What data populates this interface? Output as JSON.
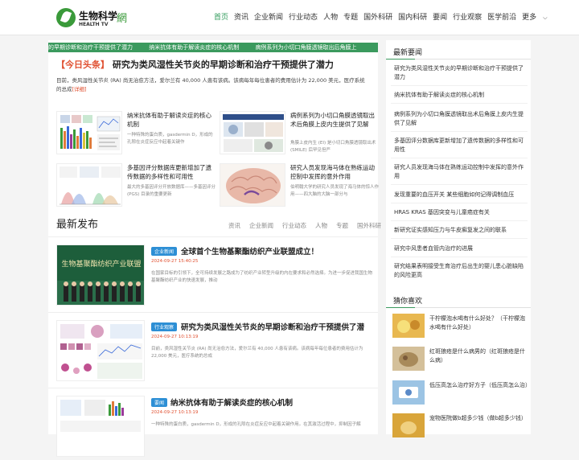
{
  "header": {
    "logo_cn": "生物科学",
    "logo_en": "HEALTH TV",
    "logo_mark": "網",
    "nav": [
      "首页",
      "资讯",
      "企业新闻",
      "行业动态",
      "人物",
      "专题",
      "国外科研",
      "国内科研",
      "要闻",
      "行业观察",
      "医学前沿",
      "更多"
    ],
    "nav_active": 0
  },
  "ticker": [
    "的早期诊断和治疗干预提供了潜力",
    "纳米抗体有助于解读炎症的核心机制",
    "病例系列为小切口角膜透镜取出后角膜上"
  ],
  "headline": {
    "tag": "【今日头条】",
    "title": "研究为类风湿性关节炎的早期诊断和治疗干预提供了潜力",
    "summary": "目前，类风湿性关节炎 (RA) 尚无治愈方法，爱尔兰有 40,000 人患有该病。该病每年每位患者的费用估计为 22,000 美元，医疗系统的总成",
    "more": "[详细]"
  },
  "cards": [
    {
      "title": "纳米抗体有助于解读炎症的核心机制",
      "desc": "一种特殊的蛋白质，gasdermin D，形成的孔隙在炎症反应中起着关键作"
    },
    {
      "title": "病例系列为小切口角膜透镜取出术后角膜上皮内生提供了见解",
      "desc": "角膜上皮内生 (EI) 是小切口角膜透镜取出术 (SMILE) 后罕见但严"
    },
    {
      "title": "多基因评分数据库更新增加了遗传数据的多样性和可用性",
      "desc": "最大的多基因评分开放数据库——多基因评分 (PGS) 目录的重要更新"
    },
    {
      "title": "研究人员发现海马体在熟练运动控制中发挥的意外作用",
      "desc": "伯明翰大学的研究人员发现了海马体的惊人作用——四大脑的大脑一部分与"
    }
  ],
  "latest": {
    "title": "最新发布",
    "tabs": [
      "资讯",
      "企业新闻",
      "行业动态",
      "人物",
      "专题",
      "国外科研"
    ]
  },
  "articles": [
    {
      "badge": "企业新闻",
      "title": "全球首个生物基聚酯纺织产业联盟成立！",
      "date": "2024-09-27 15:40:25",
      "desc": "在国家目标的引领下，全可持续发展之路成为了纺织产业转型升级的内在要求和必然选择。为进一步促进我国生物基聚酯纺织产业的快速发展，推动",
      "img_text": "生物基聚酯纺织产业联盟"
    },
    {
      "badge": "行业观察",
      "title": "研究为类风湿性关节炎的早期诊断和治疗干预提供了潜",
      "date": "2024-09-27 10:13:19",
      "desc": "目前，类风湿性关节炎 (RA) 尚无治愈方法，爱尔兰有 40,000 人患有该病。该病每年每位患者的费用估计为 22,000 美元，医疗系统的总成"
    },
    {
      "badge": "要闻",
      "title": "纳米抗体有助于解读炎症的核心机制",
      "date": "2024-09-27 10:13:19",
      "desc": "一种特殊的蛋白质，gasdermin D，形成的孔隙在炎症反应中起着关键作用。在其激活过程中，抑制因子解"
    }
  ],
  "sidebar": {
    "news_title": "最新要闻",
    "news": [
      "研究为类风湿性关节炎的早期诊断和治疗干预提供了潜力",
      "纳米抗体有助于解读炎症的核心机制",
      "病例系列为小切口角膜透镜取出术后角膜上皮内生提供了见解",
      "多基因评分数据库更新增加了遗传数据的多样性和可用性",
      "研究人员发现海马体在熟练运动控制中发挥的意外作用",
      "发现重要的血压开关 某些细胞如何记得调制血压",
      "HRAS KRAS 基因突变与儿童癌症有关",
      "新研究证实感知压力与牛皮癣复发之间的联系",
      "研究中风患者血管内治疗的进展",
      "研究结果表明接受生育治疗后出生的婴儿患心脏缺陷的风险更高"
    ],
    "guess_title": "猜你喜欢",
    "guess": [
      {
        "title": "干柠檬泡水喝有什么好处？（干柠檬泡水喝有什么好处）",
        "color": "#d9a53a"
      },
      {
        "title": "红斑狼疮是什么病男的（红斑狼疮是什么病）",
        "color": "#c9b27a"
      },
      {
        "title": "低压高怎么治疗好方子（低压高怎么治）",
        "color": "#7bb0d9"
      },
      {
        "title": "宠物医院做b超多少钱（做b超多少钱）",
        "color": "#d9a53a"
      }
    ]
  },
  "colors": {
    "accent": "#3b9a5e",
    "headline_tag": "#e05030",
    "badge": "#2d8fd5"
  }
}
